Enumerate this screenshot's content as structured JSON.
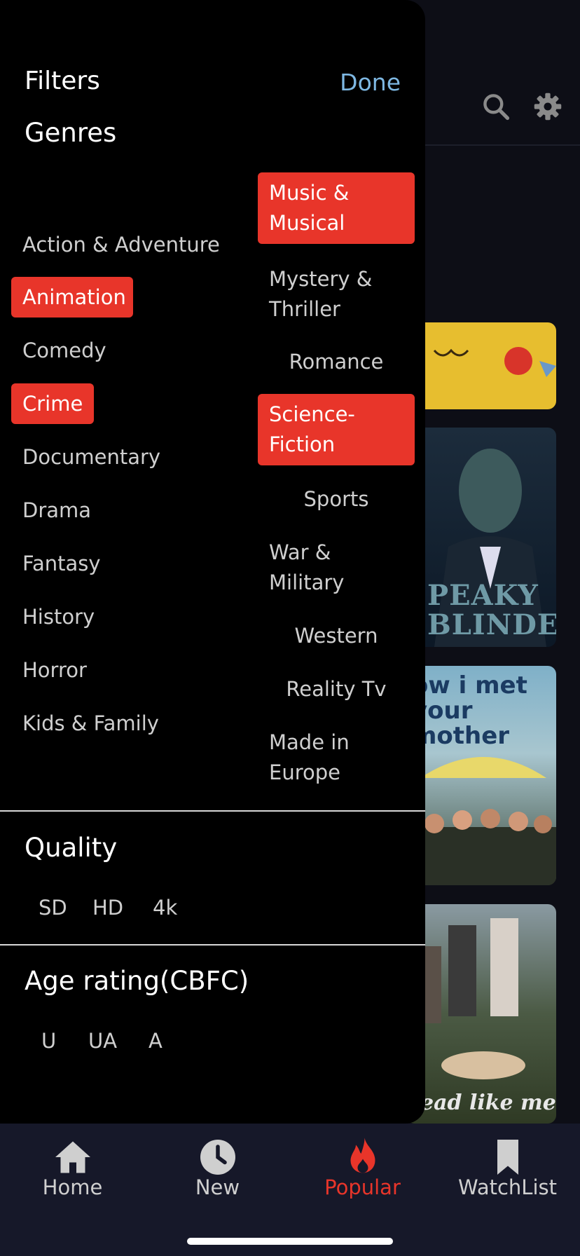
{
  "drawer": {
    "title": "Filters",
    "done_label": "Done"
  },
  "genres": {
    "title": "Genres",
    "left": [
      {
        "label": "Action & Adventure",
        "selected": false
      },
      {
        "label": "Animation",
        "selected": true
      },
      {
        "label": "Comedy",
        "selected": false
      },
      {
        "label": "Crime",
        "selected": true
      },
      {
        "label": "Documentary",
        "selected": false
      },
      {
        "label": "Drama",
        "selected": false
      },
      {
        "label": "Fantasy",
        "selected": false
      },
      {
        "label": "History",
        "selected": false
      },
      {
        "label": "Horror",
        "selected": false
      },
      {
        "label": "Kids & Family",
        "selected": false
      }
    ],
    "right": [
      {
        "label": "Music & Musical",
        "selected": true
      },
      {
        "label": "Mystery & Thriller",
        "selected": false
      },
      {
        "label": "Romance",
        "selected": false
      },
      {
        "label": "Science-Fiction",
        "selected": true
      },
      {
        "label": "Sports",
        "selected": false
      },
      {
        "label": "War & Military",
        "selected": false
      },
      {
        "label": "Western",
        "selected": false
      },
      {
        "label": "Reality Tv",
        "selected": false
      },
      {
        "label": "Made in Europe",
        "selected": false
      }
    ]
  },
  "quality": {
    "title": "Quality",
    "options": [
      "SD",
      "HD",
      "4k"
    ]
  },
  "age_rating": {
    "title": "Age rating(CBFC)",
    "options": [
      "U",
      "UA",
      "A"
    ]
  },
  "background": {
    "posters": [
      {
        "name": "pikachu",
        "text": ""
      },
      {
        "name": "peaky-blinders",
        "text": "PEAKY BLINDERS"
      },
      {
        "name": "how-i-met-your-mother",
        "text": "ow i met your mother"
      },
      {
        "name": "dead-like-me",
        "text": "ead like me"
      }
    ]
  },
  "bottom_nav": {
    "items": [
      {
        "label": "Home",
        "icon": "home-icon",
        "active": false
      },
      {
        "label": "New",
        "icon": "clock-icon",
        "active": false
      },
      {
        "label": "Popular",
        "icon": "flame-icon",
        "active": true
      },
      {
        "label": "WatchList",
        "icon": "bookmark-icon",
        "active": false
      }
    ]
  },
  "colors": {
    "accent": "#e8352a",
    "done": "#7eb8e3",
    "background": "#000000",
    "nav_background": "#161829"
  }
}
